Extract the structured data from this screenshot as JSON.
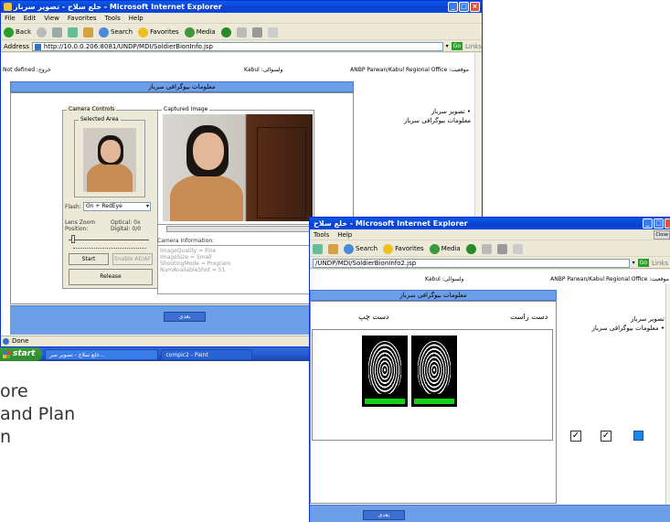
{
  "slide_text": [
    "ore",
    " and Plan",
    "n"
  ],
  "window1": {
    "title": "خلع سلاح - تصویر سرباز - Microsoft Internet Explorer",
    "menu": [
      "File",
      "Edit",
      "View",
      "Favorites",
      "Tools",
      "Help"
    ],
    "toolbar": [
      "Back",
      "Search",
      "Favorites",
      "Media"
    ],
    "address_label": "Address",
    "address_url": "http://10.0.0.206:8081/UNDP/MDI/SoldierBionInfo.jsp",
    "go_label": "Go",
    "links_label": "Links",
    "status_left": "Not defined :خروج",
    "status_center": "Kabul :ولسوالی",
    "status_right": "ANBP Parwan/Kabul Regional Office :موقعیت",
    "page_header": "معلومات بیوگرافی سرباز",
    "camera_controls": {
      "legend": "Camera Controls",
      "selected_area": "Selected Area",
      "flash_label": "Flash:",
      "flash_value": "On + RedEye",
      "lens_zoom": "Lens Zoom",
      "position": "Position:",
      "optical": "Optical: 0x",
      "digital": "Digital: 0/0",
      "start": "Start",
      "enable_ae": "Enable AE/AF",
      "release": "Release"
    },
    "captured_legend": "Captured Image",
    "camera_info": {
      "label": "Camera Information:",
      "lines": [
        "ImageQuality = Fine",
        "ImageSize = Small",
        "ShootingMode = Program",
        "NumAvailableShot = 51"
      ]
    },
    "side_items": [
      "تصویر سرباز •",
      "معلومات بیوگرافی سرباز"
    ],
    "next_button": "بعدی",
    "status_done": "Done"
  },
  "window2": {
    "title": "خلع سلاح - Microsoft Internet Explorer",
    "menu": [
      "Tools",
      "Help"
    ],
    "toolbar": [
      "Search",
      "Favorites",
      "Media"
    ],
    "address_url": "/UNDP/MDI/SoldierBionInfo2.jsp",
    "go_label": "Go",
    "links_label": "Links",
    "close_label": "Close",
    "status_center": "Kabul :ولسوالی",
    "status_right": "ANBP Parwan/Kabul Regional Office :موقعیت",
    "page_header": "معلومات بیوگرافی سرباز",
    "left_hand": "دست چپ",
    "right_hand": "دست راست",
    "side_items": [
      "تصویر سرباز",
      "معلومات بیوگرافی سرباز •"
    ],
    "next_button": "بعدی"
  },
  "taskbar": {
    "start": "start",
    "tasks": [
      "خلع سلاح - تصویر سر...",
      "compic2 - Paint"
    ]
  }
}
